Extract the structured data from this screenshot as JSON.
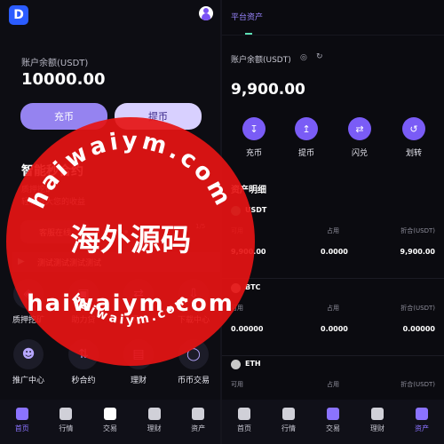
{
  "left": {
    "logo": "D",
    "balance_label": "账户余额(USDT)",
    "balance_value": "10000.00",
    "recharge_btn": "充币",
    "withdraw_btn": "提币",
    "promo": {
      "title": "智能秒合约",
      "line1": "质押挖矿",
      "line2": "轻松放大您的收益",
      "service_btn": "客服在线",
      "pager": "1/5"
    },
    "notice": "测试测试测试测试",
    "features": [
      {
        "label": "质押挖矿",
        "icon": "staking-icon"
      },
      {
        "label": "助力贷",
        "icon": "loan-icon"
      },
      {
        "label": "闪兑",
        "icon": "swap-icon"
      },
      {
        "label": "下载中心",
        "icon": "download-icon"
      },
      {
        "label": "推广中心",
        "icon": "promotion-icon"
      },
      {
        "label": "秒合约",
        "icon": "contract-icon"
      },
      {
        "label": "理财",
        "icon": "finance-icon"
      },
      {
        "label": "币币交易",
        "icon": "spot-trading-icon"
      }
    ]
  },
  "nav": [
    {
      "label": "首页",
      "icon": "home-icon"
    },
    {
      "label": "行情",
      "icon": "market-icon"
    },
    {
      "label": "交易",
      "icon": "trade-icon"
    },
    {
      "label": "理财",
      "icon": "finance-icon"
    },
    {
      "label": "资产",
      "icon": "wallet-icon"
    }
  ],
  "right": {
    "tab": "平台资产",
    "balance_label": "账户余额(USDT)",
    "balance_value": "9,900.00",
    "actions": [
      {
        "label": "充币",
        "icon": "deposit-icon"
      },
      {
        "label": "提币",
        "icon": "withdraw-icon"
      },
      {
        "label": "闪兑",
        "icon": "swap-icon"
      },
      {
        "label": "划转",
        "icon": "transfer-icon"
      }
    ],
    "section_title": "资产明细",
    "col_available": "可用",
    "col_frozen": "占用",
    "col_converted": "折合(USDT)",
    "assets": [
      {
        "name": "USDT",
        "available": "9,900.00",
        "frozen": "0.0000",
        "converted": "9,900.00",
        "color": "#26a17b"
      },
      {
        "name": "BTC",
        "available": "0.00000",
        "frozen": "0.0000",
        "converted": "0.00000",
        "color": "#c9c9c9"
      },
      {
        "name": "ETH",
        "available": "",
        "frozen": "",
        "converted": "",
        "color": "#c9c9c9"
      }
    ]
  },
  "watermark": {
    "top_arc": "haiwaiym.com",
    "center": "海外源码",
    "middle": "haiwaiym.com",
    "bottom_arc": "haiwaiym.com",
    "color": "#e31b1b"
  }
}
